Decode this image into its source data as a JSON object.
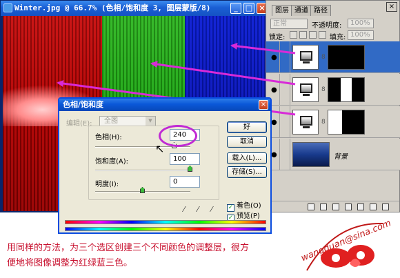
{
  "document_window": {
    "title": "Winter.jpg @ 66.7% (色相/饱和度 3, 图层蒙版/8)",
    "minimize_glyph": "_",
    "maximize_glyph": "□",
    "close_glyph": "×",
    "bands": [
      "red",
      "green",
      "blue"
    ]
  },
  "layers_panel": {
    "tabs": [
      "图层",
      "通道",
      "路径"
    ],
    "close_glyph": "×",
    "blend_mode": "正常",
    "opacity_label": "不透明度:",
    "opacity_value": "100%",
    "lock_label": "锁定:",
    "fill_label": "填充:",
    "fill_value": "100%",
    "layers": [
      {
        "type": "adjustment",
        "mask": "white-left",
        "selected": true
      },
      {
        "type": "adjustment",
        "mask": "white-middle",
        "selected": false
      },
      {
        "type": "adjustment",
        "mask": "white-right",
        "selected": false
      },
      {
        "type": "background",
        "name": "背景",
        "selected": false
      }
    ]
  },
  "dialog": {
    "title": "色相/饱和度",
    "close_glyph": "×",
    "edit_label": "编辑(E):",
    "edit_value": "全图",
    "hue_label": "色相(H):",
    "hue_value": "240",
    "saturation_label": "饱和度(A):",
    "saturation_value": "100",
    "lightness_label": "明度(I):",
    "lightness_value": "0",
    "buttons": {
      "ok": "好",
      "cancel": "取消",
      "load": "载入(L)...",
      "save": "存储(S)..."
    },
    "colorize_label": "着色(O)",
    "preview_label": "预览(P)",
    "colorize_checked": true,
    "preview_checked": true,
    "hue_slider_fraction": 0.833,
    "saturation_slider_fraction": 1.0,
    "lightness_slider_fraction": 0.5
  },
  "caption": {
    "line1": "用同样的方法，为三个选区创建三个不同颜色的调整层，很方",
    "line2": "便地将图像调整为红绿蓝三色。"
  },
  "colors": {
    "arrow": "#d82ad8",
    "caption": "#c8102e",
    "highlight_ring": "#c02ad4"
  }
}
